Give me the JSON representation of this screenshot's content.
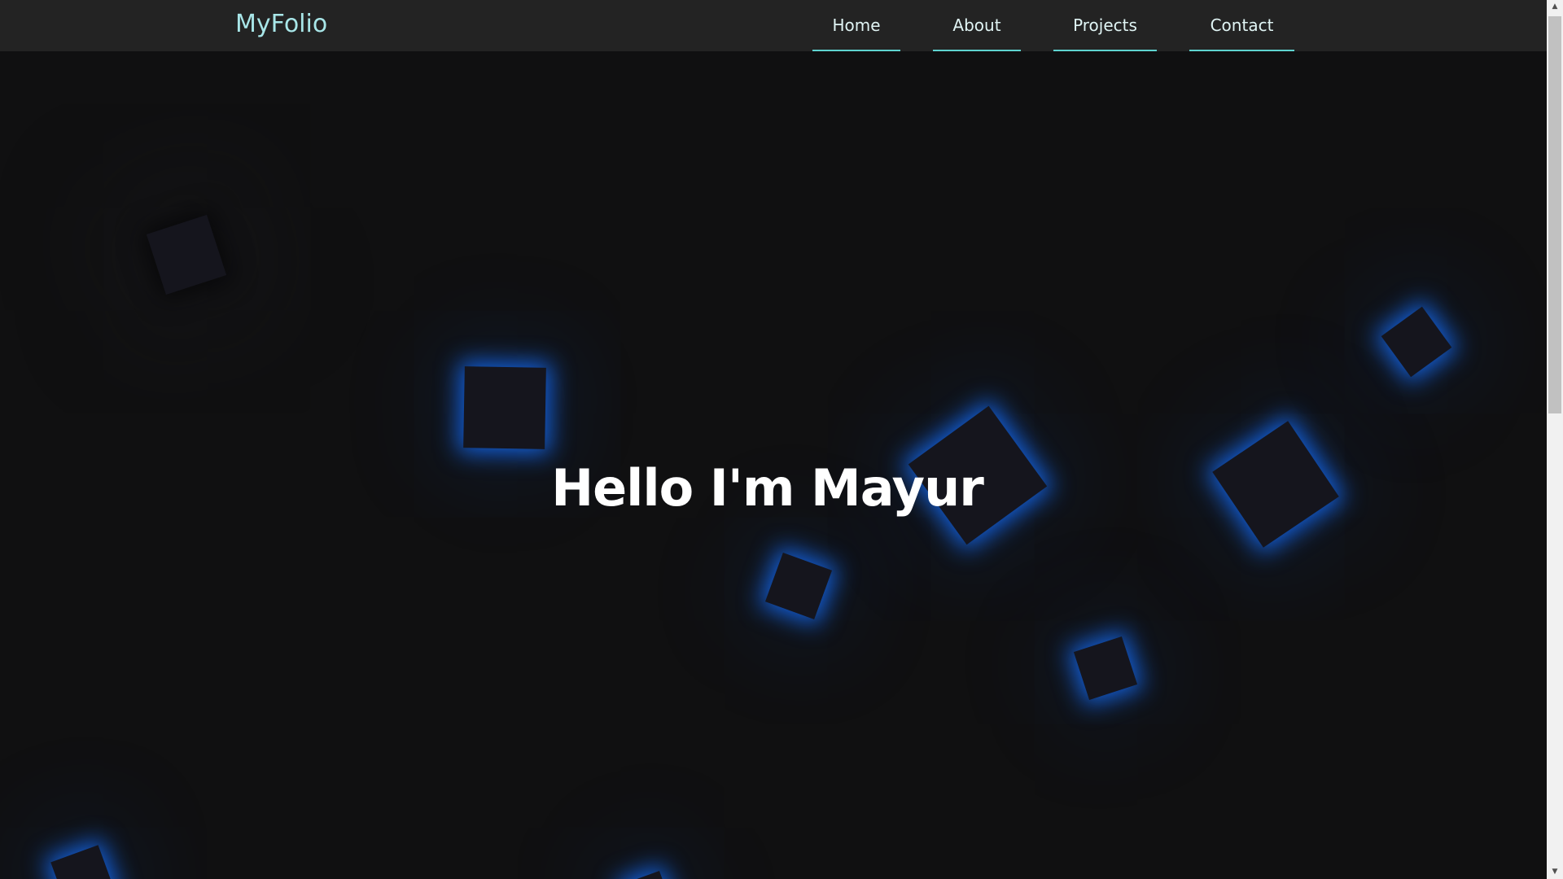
{
  "header": {
    "logo": "MyFolio",
    "nav": [
      {
        "label": "Home"
      },
      {
        "label": "About"
      },
      {
        "label": "Projects"
      },
      {
        "label": "Contact"
      }
    ]
  },
  "hero": {
    "title": "Hello I'm Mayur"
  },
  "icons": {
    "scroll_up": "▲",
    "scroll_down": "▼"
  },
  "colors": {
    "accent": "#5fd3d0",
    "logo": "#a8e6e8",
    "glow": "#1e6eff",
    "background": "#101011",
    "navbar": "#232323"
  }
}
